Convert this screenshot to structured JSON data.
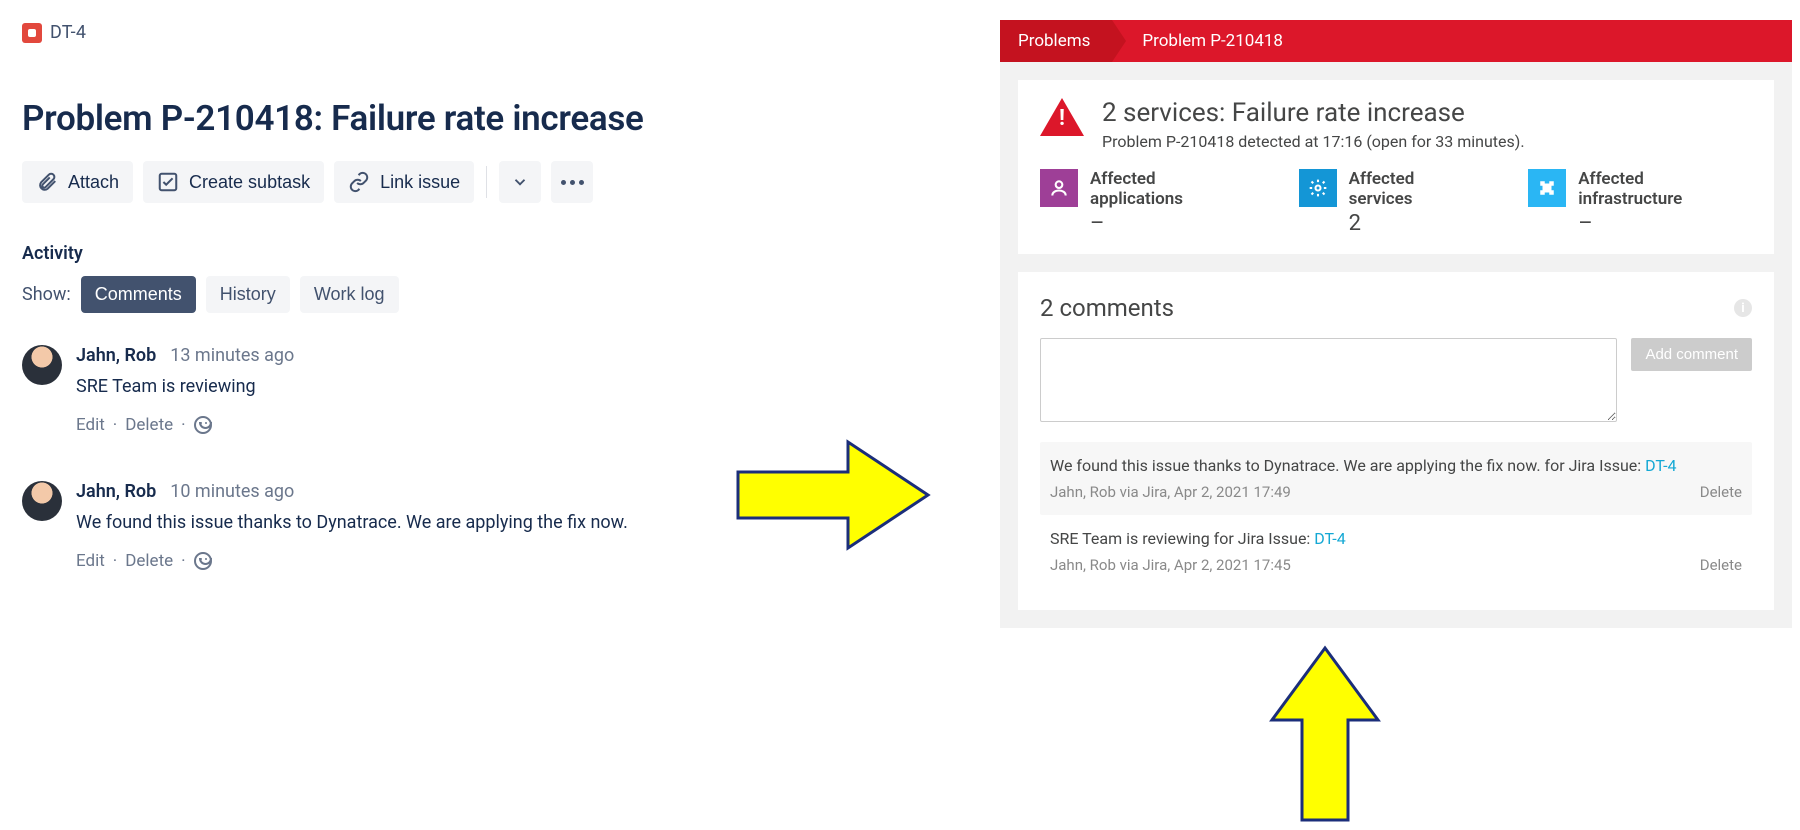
{
  "jira": {
    "issue_key": "DT-4",
    "title": "Problem P-210418: Failure rate increase",
    "toolbar": {
      "attach": "Attach",
      "create_subtask": "Create subtask",
      "link_issue": "Link issue"
    },
    "activity_heading": "Activity",
    "show_label": "Show:",
    "tabs": {
      "comments": "Comments",
      "history": "History",
      "worklog": "Work log"
    },
    "actions": {
      "edit": "Edit",
      "delete": "Delete"
    },
    "comments": [
      {
        "author": "Jahn, Rob",
        "ago": "13 minutes ago",
        "text": "SRE Team is reviewing"
      },
      {
        "author": "Jahn, Rob",
        "ago": "10 minutes ago",
        "text": "We found this issue thanks to Dynatrace. We are applying the fix now."
      }
    ]
  },
  "dt": {
    "breadcrumb": {
      "root": "Problems",
      "current": "Problem P-210418"
    },
    "problem_title": "2 services: Failure rate increase",
    "problem_subtitle": "Problem P-210418 detected at 17:16 (open for 33 minutes).",
    "metrics": {
      "apps": {
        "label": "Affected applications",
        "value": "–"
      },
      "svcs": {
        "label": "Affected services",
        "value": "2"
      },
      "infra": {
        "label": "Affected infrastructure",
        "value": "–"
      }
    },
    "comments_title": "2 comments",
    "add_button": "Add comment",
    "delete_label": "Delete",
    "comments": [
      {
        "text_prefix": "We found this issue thanks to Dynatrace. We are applying the fix now. for Jira Issue: ",
        "link": "DT-4",
        "meta": "Jahn, Rob via Jira, Apr 2, 2021 17:49"
      },
      {
        "text_prefix": "SRE Team is reviewing for Jira Issue: ",
        "link": "DT-4",
        "meta": "Jahn, Rob via Jira, Apr 2, 2021 17:45"
      }
    ]
  }
}
